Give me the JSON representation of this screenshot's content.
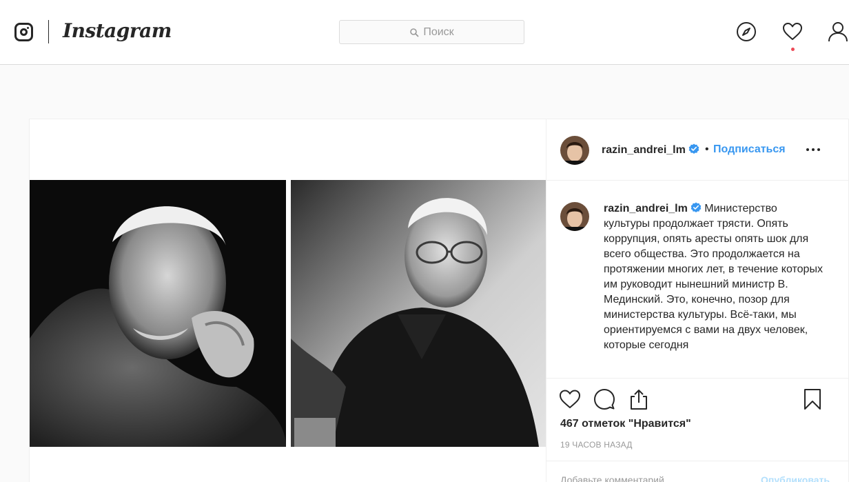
{
  "header": {
    "wordmark": "Instagram",
    "search_placeholder": "Поиск",
    "notification_dot_color": "#ed4956"
  },
  "post": {
    "author": {
      "username": "razin_andrei_lm",
      "verified": true,
      "follow_label": "Подписаться",
      "separator": "•"
    },
    "caption": {
      "username": "razin_andrei_lm",
      "text": "Министерство культуры продолжает трясти. Опять коррупция, опять аресты опять шок для всего общества. Это продолжается на протяжении многих лет, в течение которых им руководит нынешний министр В. Мединский. Это, конечно, позор для министерства культуры. Всё-таки, мы ориентируемся с вами на двух человек, которые сегодня"
    },
    "likes_label": "467 отметок \"Нравится\"",
    "time_label": "19 ЧАСОВ НАЗАД",
    "comment_placeholder": "Добавьте комментарий...",
    "comment_post_label": "Опубликовать"
  },
  "icons": {
    "header": [
      "instagram-glyph-icon",
      "search-icon",
      "compass-icon",
      "heart-icon",
      "user-icon"
    ],
    "post": [
      "verified-badge-icon",
      "more-options-icon",
      "like-icon",
      "comment-icon",
      "share-icon",
      "bookmark-icon"
    ]
  },
  "colors": {
    "link_blue": "#3897f0",
    "verified_blue": "#3897f0",
    "border": "#dbdbdb",
    "muted_text": "#999999"
  }
}
